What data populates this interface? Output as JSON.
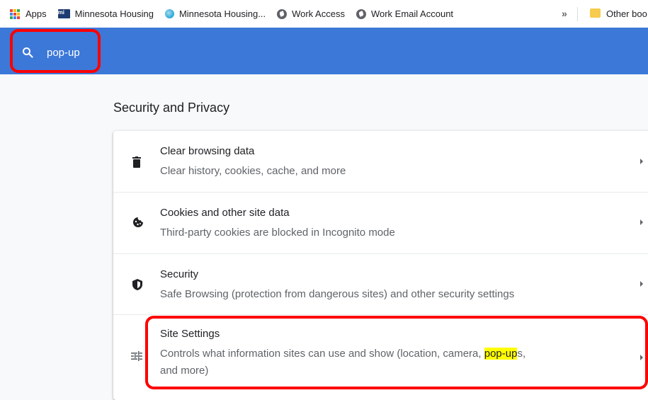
{
  "bookmarks": {
    "apps": "Apps",
    "mh1": "Minnesota Housing",
    "mh2": "Minnesota Housing...",
    "work_access": "Work Access",
    "work_email": "Work Email Account",
    "more": "»",
    "other": "Other boo"
  },
  "search": {
    "value": "pop-up"
  },
  "section": {
    "title": "Security and Privacy",
    "items": [
      {
        "title": "Clear browsing data",
        "desc": "Clear history, cookies, cache, and more"
      },
      {
        "title": "Cookies and other site data",
        "desc": "Third-party cookies are blocked in Incognito mode"
      },
      {
        "title": "Security",
        "desc": "Safe Browsing (protection from dangerous sites) and other security settings"
      },
      {
        "title": "Site Settings",
        "desc_pre": "Controls what information sites can use and show (location, camera, ",
        "desc_hl": "pop-up",
        "desc_post": "s,",
        "desc_line2": "and more)"
      }
    ]
  },
  "colors": {
    "toolbar": "#3c78d8",
    "annotation": "#ff0000",
    "highlight": "#ffff00"
  }
}
